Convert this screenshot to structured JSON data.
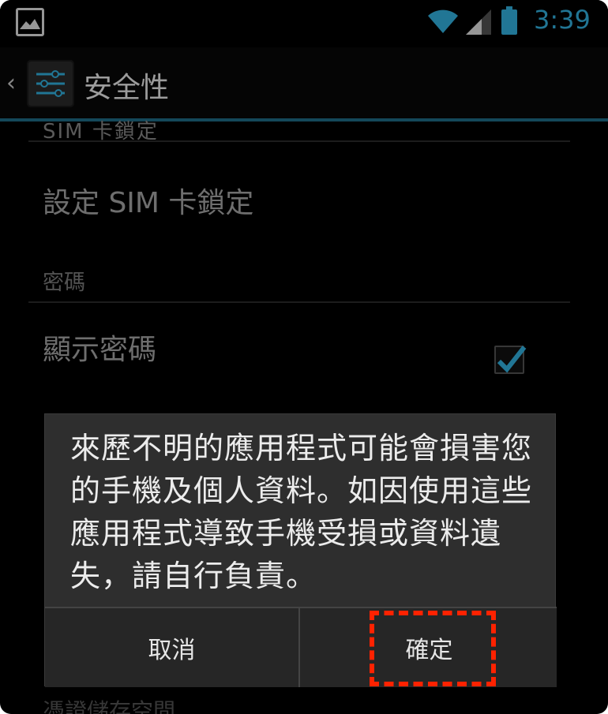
{
  "status_bar": {
    "time": "3:39",
    "icons": [
      "image-notification-icon",
      "wifi-icon",
      "signal-icon",
      "battery-icon"
    ],
    "accent_color": "#33b5e5"
  },
  "action_bar": {
    "title": "安全性",
    "icon": "settings-sliders-icon"
  },
  "settings": {
    "partial_section_header": "SIM 卡鎖定",
    "sim_lock_item": "設定 SIM 卡鎖定",
    "password_section_header": "密碼",
    "show_password_item": "顯示密碼",
    "show_password_checked": true,
    "partial_bottom_section": "憑證儲存空間"
  },
  "dialog": {
    "message": "來歷不明的應用程式可能會損害您的手機及個人資料。如因使用這些應用程式導致手機受損或資料遺失，請自行負責。",
    "cancel_label": "取消",
    "ok_label": "確定"
  },
  "colors": {
    "annotation_highlight": "#ff2200",
    "action_bar_underline": "#1f6f8b"
  }
}
